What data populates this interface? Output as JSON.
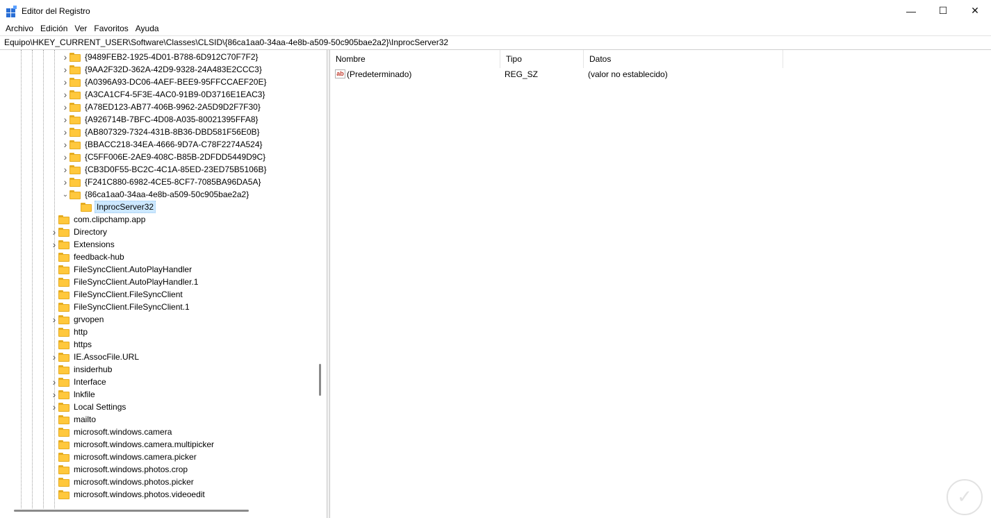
{
  "window": {
    "title": "Editor del Registro",
    "controls": {
      "minimize": "—",
      "maximize": "☐",
      "close": "✕"
    }
  },
  "menu": [
    "Archivo",
    "Edición",
    "Ver",
    "Favoritos",
    "Ayuda"
  ],
  "address": "Equipo\\HKEY_CURRENT_USER\\Software\\Classes\\CLSID\\{86ca1aa0-34aa-4e8b-a509-50c905bae2a2}\\InprocServer32",
  "tree": {
    "clsid_keys": [
      "{9489FEB2-1925-4D01-B788-6D912C70F7F2}",
      "{9AA2F32D-362A-42D9-9328-24A483E2CCC3}",
      "{A0396A93-DC06-4AEF-BEE9-95FFCCAEF20E}",
      "{A3CA1CF4-5F3E-4AC0-91B9-0D3716E1EAC3}",
      "{A78ED123-AB77-406B-9962-2A5D9D2F7F30}",
      "{A926714B-7BFC-4D08-A035-80021395FFA8}",
      "{AB807329-7324-431B-8B36-DBD581F56E0B}",
      "{BBACC218-34EA-4666-9D7A-C78F2274A524}",
      "{C5FF006E-2AE9-408C-B85B-2DFDD5449D9C}",
      "{CB3D0F55-BC2C-4C1A-85ED-23ED75B5106B}",
      "{F241C880-6982-4CE5-8CF7-7085BA96DA5A}",
      "{86ca1aa0-34aa-4e8b-a509-50c905bae2a2}"
    ],
    "selected_child": "InprocServer32",
    "classes_keys": [
      "com.clipchamp.app",
      "Directory",
      "Extensions",
      "feedback-hub",
      "FileSyncClient.AutoPlayHandler",
      "FileSyncClient.AutoPlayHandler.1",
      "FileSyncClient.FileSyncClient",
      "FileSyncClient.FileSyncClient.1",
      "grvopen",
      "http",
      "https",
      "IE.AssocFile.URL",
      "insiderhub",
      "Interface",
      "lnkfile",
      "Local Settings",
      "mailto",
      "microsoft.windows.camera",
      "microsoft.windows.camera.multipicker",
      "microsoft.windows.camera.picker",
      "microsoft.windows.photos.crop",
      "microsoft.windows.photos.picker",
      "microsoft.windows.photos.videoedit"
    ]
  },
  "list": {
    "headers": {
      "name": "Nombre",
      "type": "Tipo",
      "data": "Datos"
    },
    "rows": [
      {
        "name": "(Predeterminado)",
        "type": "REG_SZ",
        "data": "(valor no establecido)"
      }
    ]
  }
}
